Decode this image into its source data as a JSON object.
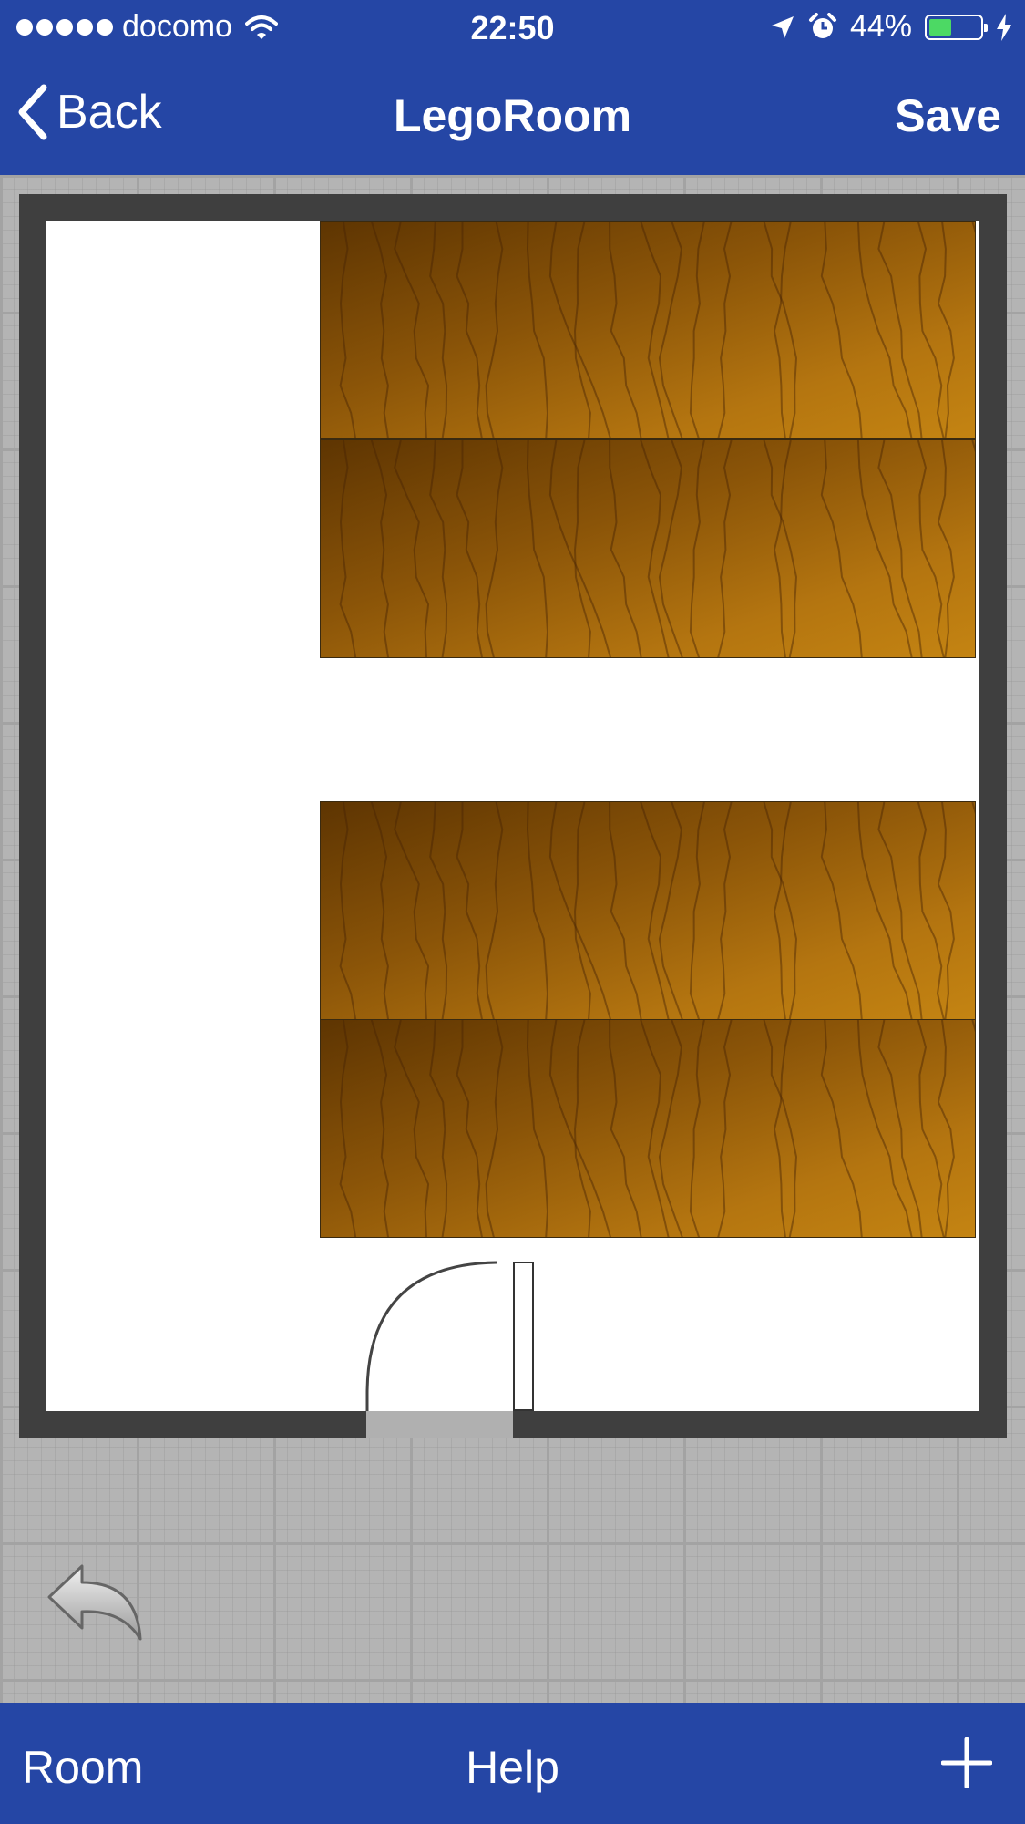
{
  "status_bar": {
    "carrier": "docomo",
    "time": "22:50",
    "battery_percent_label": "44%",
    "battery_level": 0.44,
    "icons": [
      "signal-dots-icon",
      "wifi-icon",
      "location-arrow-icon",
      "alarm-clock-icon",
      "battery-icon",
      "charging-bolt-icon"
    ]
  },
  "nav_bar": {
    "back_label": "Back",
    "title": "LegoRoom",
    "save_label": "Save"
  },
  "toolbar": {
    "room_label": "Room",
    "help_label": "Help",
    "add_icon": "plus-icon"
  },
  "colors": {
    "brand_blue": "#2546a5",
    "wall": "#3f3f3f",
    "floor": "#ffffff",
    "canvas_grid": "#b4b4b4",
    "wood_dark": "#5e3502",
    "wood_light": "#c48412",
    "battery_fill": "#4cd964"
  },
  "canvas": {
    "furniture": [
      "desk",
      "desk",
      "desk",
      "desk"
    ],
    "fixtures": [
      "door"
    ],
    "undo_icon": "undo-arrow-icon"
  }
}
